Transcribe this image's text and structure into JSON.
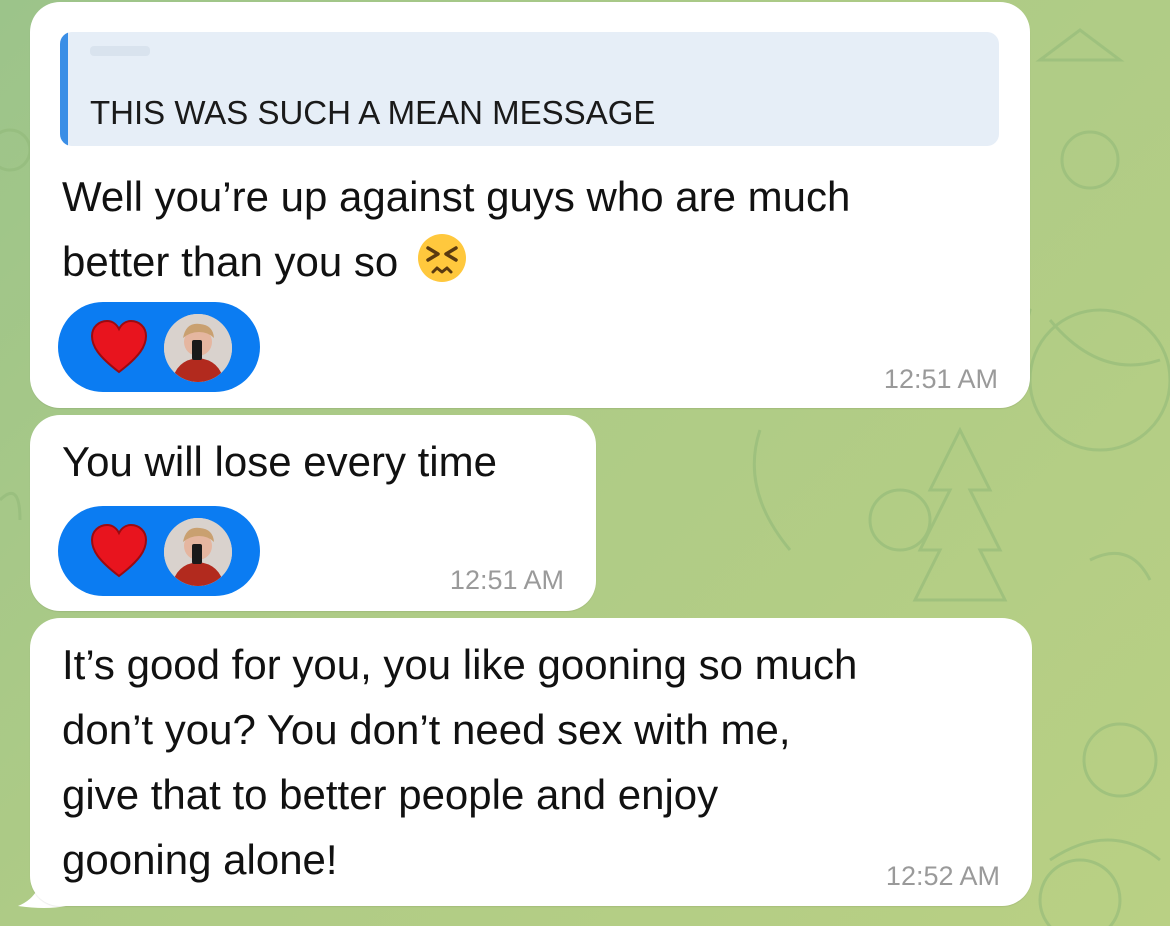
{
  "messages": [
    {
      "reply_to": "THIS WAS SUCH A MEAN MESSAGE",
      "lines": [
        "Well you’re up against guys who are much",
        "better than you so"
      ],
      "emoji": "persevering-face",
      "reaction": {
        "emoji": "heart",
        "has_avatar": true
      },
      "time": "12:51 AM"
    },
    {
      "lines": [
        "You will lose every time"
      ],
      "reaction": {
        "emoji": "heart",
        "has_avatar": true
      },
      "time": "12:51 AM"
    },
    {
      "lines": [
        "It’s good for you, you like gooning so much",
        "don’t you? You don’t need sex with me,",
        "give that to better people and enjoy",
        "gooning alone!"
      ],
      "time": "12:52 AM"
    }
  ],
  "colors": {
    "reaction_bg": "#0b7cf2",
    "reply_accent": "#3a8ee6",
    "bubble_bg": "#ffffff",
    "heart": "#e8141e"
  }
}
